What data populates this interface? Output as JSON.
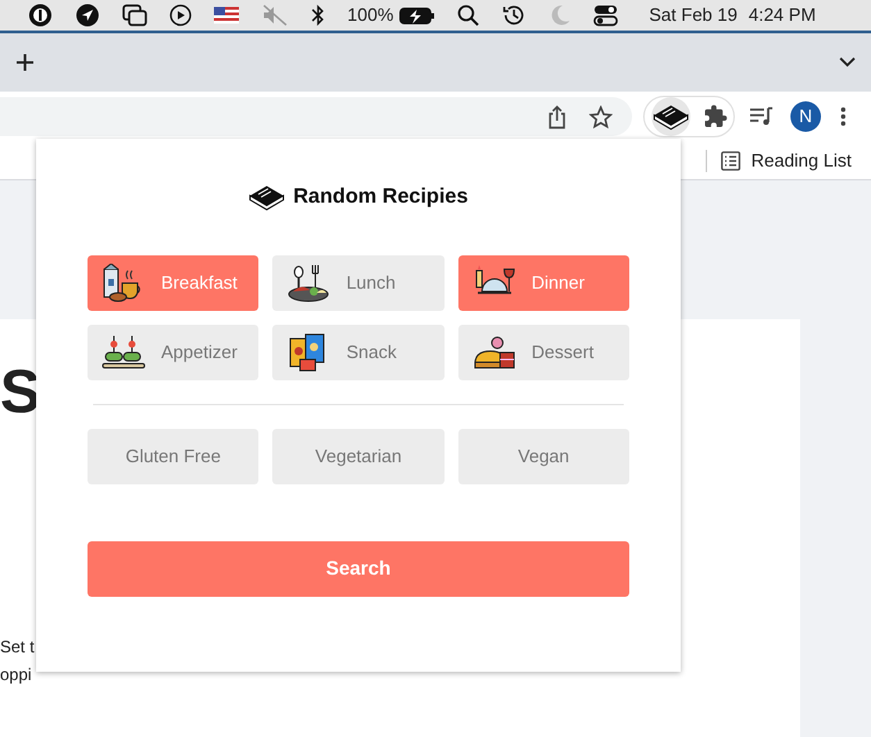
{
  "menubar": {
    "battery": "100%",
    "date": "Sat Feb 19",
    "time": "4:24 PM"
  },
  "toolbar": {
    "avatar": "N"
  },
  "bookmarks_bar": {
    "reading_list": "Reading List"
  },
  "page": {
    "heading": "S",
    "lines": [
      "Set t",
      "oppi"
    ]
  },
  "popup": {
    "title": "Random Recipies",
    "meals": [
      {
        "label": "Breakfast",
        "kind": "breakfast",
        "selected": true
      },
      {
        "label": "Lunch",
        "kind": "lunch",
        "selected": false
      },
      {
        "label": "Dinner",
        "kind": "dinner",
        "selected": true
      },
      {
        "label": "Appetizer",
        "kind": "appetizer",
        "selected": false
      },
      {
        "label": "Snack",
        "kind": "snack",
        "selected": false
      },
      {
        "label": "Dessert",
        "kind": "dessert",
        "selected": false
      }
    ],
    "diets": [
      {
        "label": "Gluten Free",
        "selected": false
      },
      {
        "label": "Vegetarian",
        "selected": false
      },
      {
        "label": "Vegan",
        "selected": false
      }
    ],
    "search_button": "Search"
  }
}
